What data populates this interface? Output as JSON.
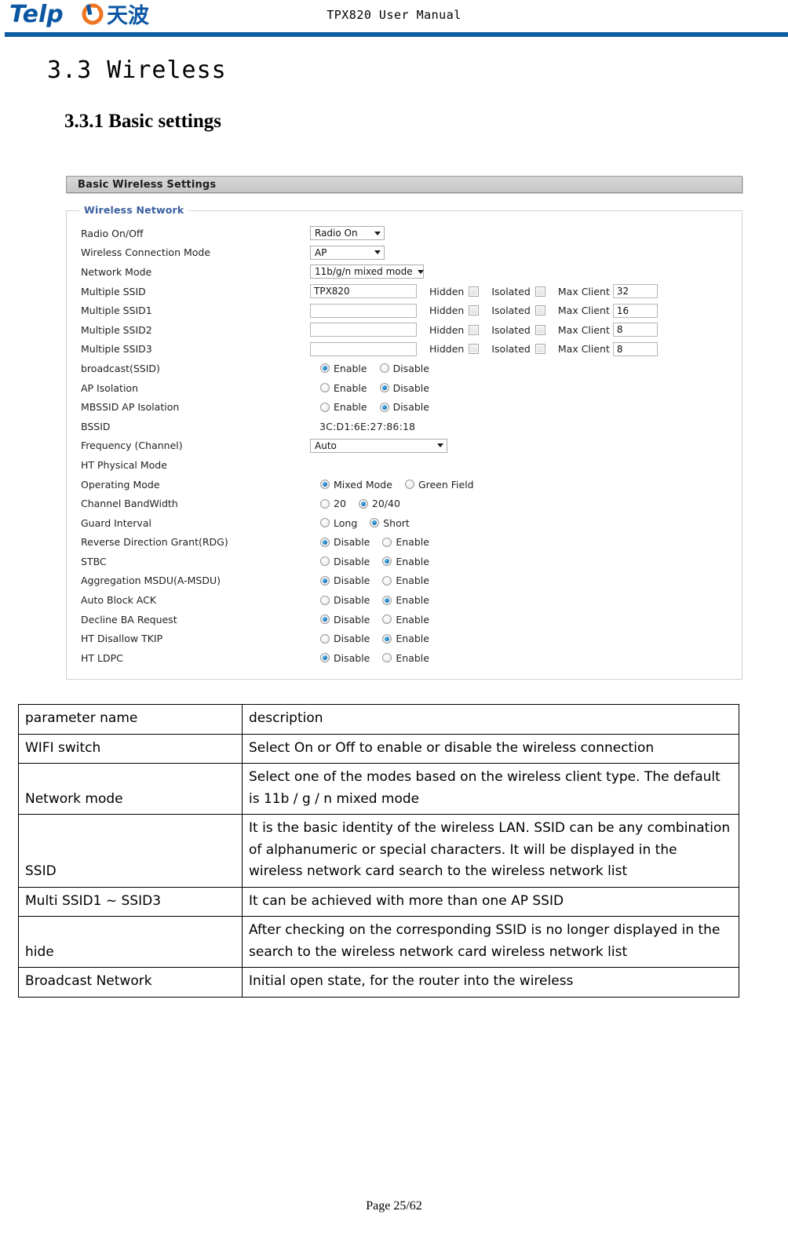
{
  "header": {
    "logo_text_latin": "Telp",
    "logo_text_cjk": "天波",
    "title": "TPX820 User Manual",
    "rule_color": "#0f5ca3",
    "logo_blue": "#0b57a4",
    "logo_orange": "#ee7521"
  },
  "headings": {
    "section": "3.3 Wireless",
    "subsection": "3.3.1 Basic settings"
  },
  "screenshot": {
    "titlebar": "Basic Wireless Settings",
    "legend": "Wireless Network",
    "labels": {
      "radio_on_off": "Radio On/Off",
      "wireless_connection_mode": "Wireless Connection Mode",
      "network_mode": "Network Mode",
      "multiple_ssid": "Multiple SSID",
      "multiple_ssid1": "Multiple SSID1",
      "multiple_ssid2": "Multiple SSID2",
      "multiple_ssid3": "Multiple SSID3",
      "broadcast_ssid": "broadcast(SSID)",
      "ap_isolation": "AP Isolation",
      "mbssid_ap_isolation": "MBSSID AP Isolation",
      "bssid": "BSSID",
      "frequency_channel": "Frequency (Channel)",
      "ht_physical_mode": "HT Physical Mode",
      "operating_mode": "Operating Mode",
      "channel_bandwidth": "Channel BandWidth",
      "guard_interval": "Guard Interval",
      "rdg": "Reverse Direction Grant(RDG)",
      "stbc": "STBC",
      "amsdu": "Aggregation MSDU(A-MSDU)",
      "auto_block_ack": "Auto Block ACK",
      "decline_ba_request": "Decline BA Request",
      "ht_disallow_tkip": "HT Disallow TKIP",
      "ht_ldpc": "HT LDPC"
    },
    "values": {
      "radio_on_off": "Radio On",
      "wireless_connection_mode": "AP",
      "network_mode": "11b/g/n mixed mode",
      "bssid": "3C:D1:6E:27:86:18",
      "frequency_channel": "Auto"
    },
    "ssid_rows": [
      {
        "ssid": "TPX820",
        "hidden_label": "Hidden",
        "hidden_checked": false,
        "isolated_label": "Isolated",
        "isolated_checked": false,
        "maxclient_label": "Max Client",
        "maxclient": "32"
      },
      {
        "ssid": "",
        "hidden_label": "Hidden",
        "hidden_checked": false,
        "isolated_label": "Isolated",
        "isolated_checked": false,
        "maxclient_label": "Max Client",
        "maxclient": "16"
      },
      {
        "ssid": "",
        "hidden_label": "Hidden",
        "hidden_checked": false,
        "isolated_label": "Isolated",
        "isolated_checked": false,
        "maxclient_label": "Max Client",
        "maxclient": "8"
      },
      {
        "ssid": "",
        "hidden_label": "Hidden",
        "hidden_checked": false,
        "isolated_label": "Isolated",
        "isolated_checked": false,
        "maxclient_label": "Max Client",
        "maxclient": "8"
      }
    ],
    "radio_rows": {
      "broadcast_ssid": {
        "opt1": "Enable",
        "opt2": "Disable",
        "selected": 1
      },
      "ap_isolation": {
        "opt1": "Enable",
        "opt2": "Disable",
        "selected": 2
      },
      "mbssid_ap_isolation": {
        "opt1": "Enable",
        "opt2": "Disable",
        "selected": 2
      },
      "operating_mode": {
        "opt1": "Mixed Mode",
        "opt2": "Green Field",
        "selected": 1
      },
      "channel_bandwidth": {
        "opt1": "20",
        "opt2": "20/40",
        "selected": 2
      },
      "guard_interval": {
        "opt1": "Long",
        "opt2": "Short",
        "selected": 2
      },
      "rdg": {
        "opt1": "Disable",
        "opt2": "Enable",
        "selected": 1
      },
      "stbc": {
        "opt1": "Disable",
        "opt2": "Enable",
        "selected": 2
      },
      "amsdu": {
        "opt1": "Disable",
        "opt2": "Enable",
        "selected": 1
      },
      "auto_block_ack": {
        "opt1": "Disable",
        "opt2": "Enable",
        "selected": 2
      },
      "decline_ba_request": {
        "opt1": "Disable",
        "opt2": "Enable",
        "selected": 1
      },
      "ht_disallow_tkip": {
        "opt1": "Disable",
        "opt2": "Enable",
        "selected": 2
      },
      "ht_ldpc": {
        "opt1": "Disable",
        "opt2": "Enable",
        "selected": 1
      }
    }
  },
  "table": {
    "headers": [
      "parameter name",
      "description"
    ],
    "rows": [
      {
        "name": "WIFI switch",
        "desc": "Select On or Off to enable or disable the wireless connection"
      },
      {
        "name": "Network mode",
        "desc": "Select one of the modes based on the wireless client type. The default is 11b / g / n mixed mode"
      },
      {
        "name": "SSID",
        "desc": "It is the basic identity of the wireless LAN. SSID can be any combination of alphanumeric or special characters. It will be displayed in the wireless network card search to the wireless network list"
      },
      {
        "name": "Multi SSID1 ~ SSID3",
        "desc": "It can be achieved with more than one AP SSID"
      },
      {
        "name": "hide",
        "desc": "After checking on the corresponding SSID is no longer displayed in the search to the wireless network card wireless network list"
      },
      {
        "name": "Broadcast Network",
        "desc": "Initial open state, for the router into the wireless"
      }
    ]
  },
  "footer": {
    "page": "Page 25/62"
  }
}
